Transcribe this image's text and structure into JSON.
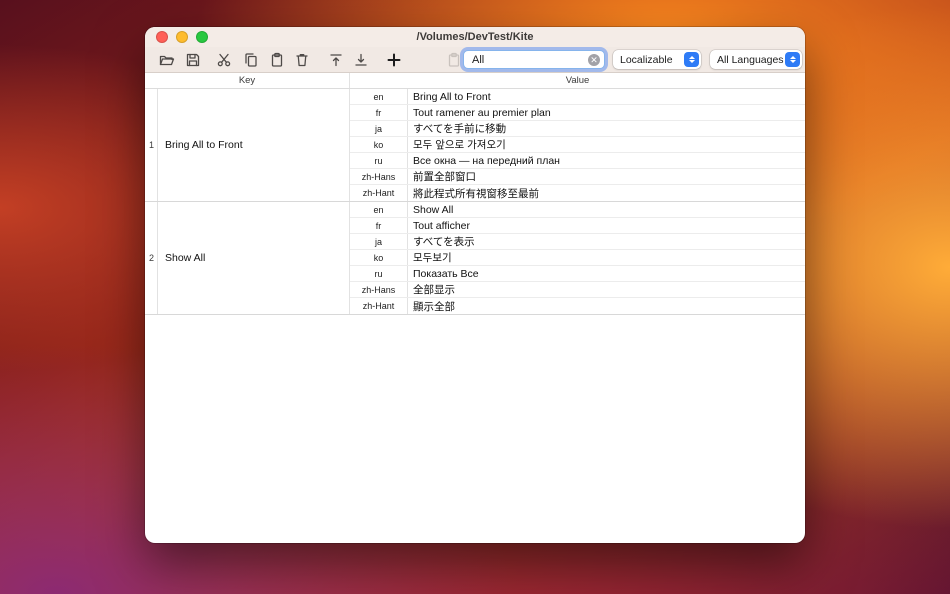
{
  "window": {
    "title": "/Volumes/DevTest/Kite"
  },
  "colors": {
    "close_btn": "#ff5f57",
    "minimize_btn": "#febc2e",
    "zoom_btn": "#28c840",
    "popup_accent": "#2e7bf6",
    "focus_ring": "#3478f6"
  },
  "toolbar": {
    "search_value": "All",
    "table_dropdown": "Localizable",
    "language_dropdown": "All Languages",
    "icons": [
      "open-folder",
      "save",
      "cut",
      "copy",
      "paste",
      "delete",
      "move-to-top",
      "move-to-bottom",
      "add",
      "filter-disabled"
    ]
  },
  "table": {
    "key_header": "Key",
    "value_header": "Value",
    "groups": [
      {
        "index": 1,
        "key": "Bring All to Front",
        "entries": [
          {
            "lang": "en",
            "value": "Bring All to Front"
          },
          {
            "lang": "fr",
            "value": "Tout ramener au premier plan"
          },
          {
            "lang": "ja",
            "value": "すべてを手前に移動"
          },
          {
            "lang": "ko",
            "value": "모두 앞으로 가져오기"
          },
          {
            "lang": "ru",
            "value": "Все окна — на передний план"
          },
          {
            "lang": "zh-Hans",
            "value": "前置全部窗口"
          },
          {
            "lang": "zh-Hant",
            "value": "將此程式所有視窗移至最前"
          }
        ]
      },
      {
        "index": 2,
        "key": "Show All",
        "entries": [
          {
            "lang": "en",
            "value": "Show All"
          },
          {
            "lang": "fr",
            "value": "Tout afficher"
          },
          {
            "lang": "ja",
            "value": "すべてを表示"
          },
          {
            "lang": "ko",
            "value": "모두보기"
          },
          {
            "lang": "ru",
            "value": "Показать Все"
          },
          {
            "lang": "zh-Hans",
            "value": "全部显示"
          },
          {
            "lang": "zh-Hant",
            "value": "顯示全部"
          }
        ]
      }
    ]
  }
}
